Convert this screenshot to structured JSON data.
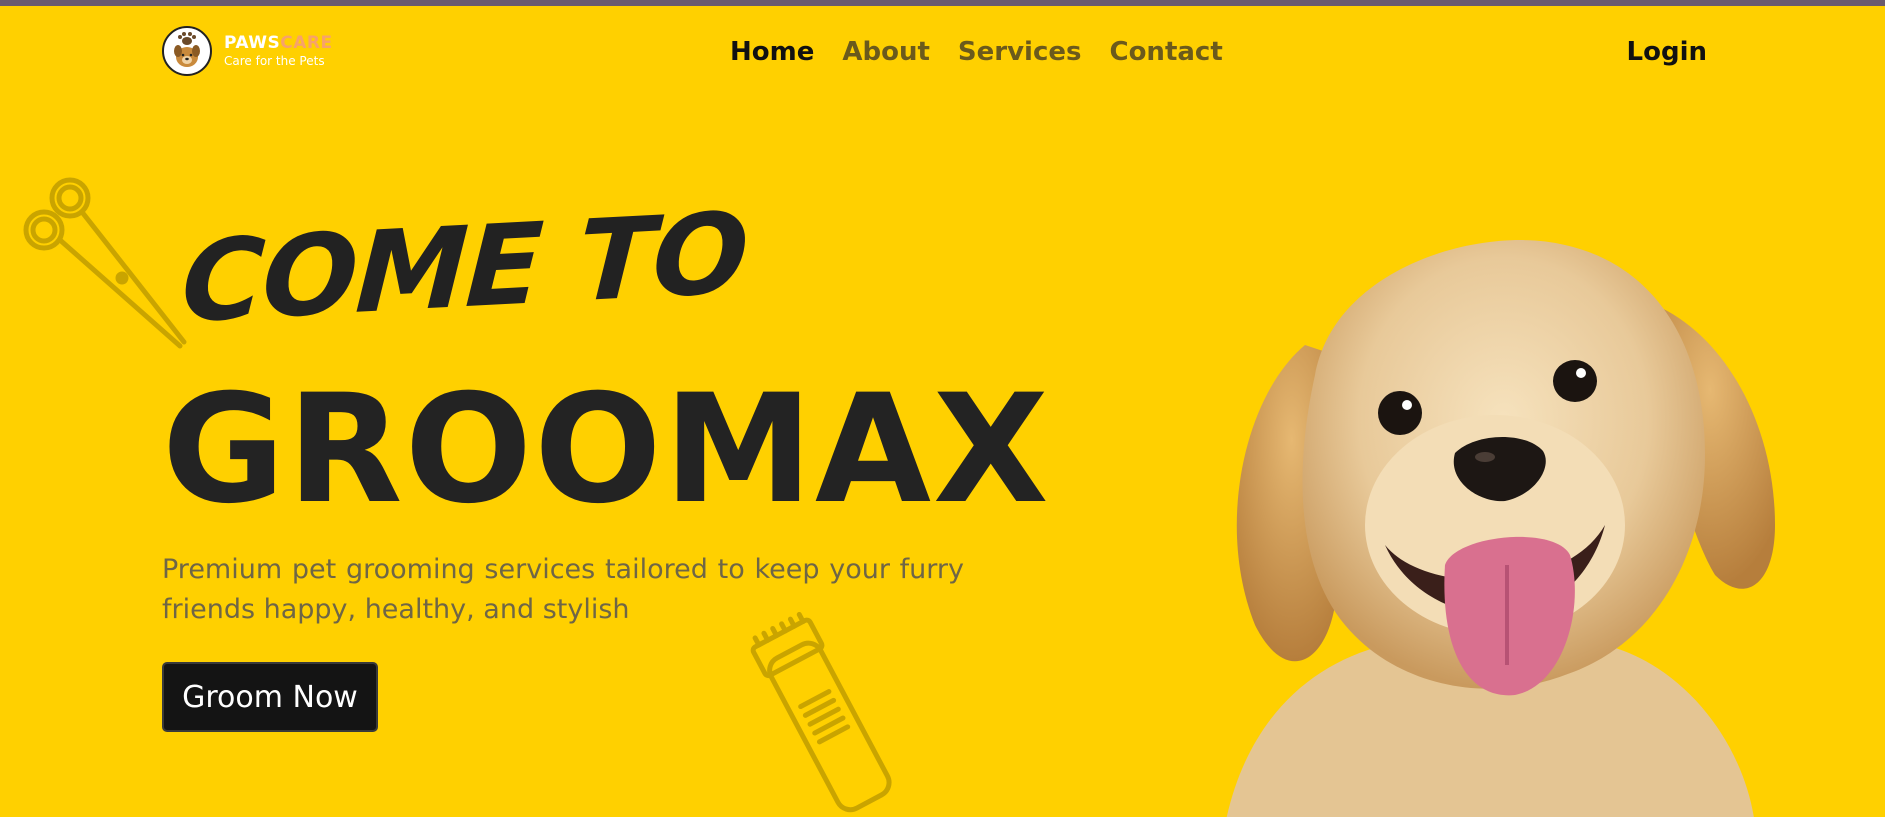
{
  "brand": {
    "name_part1": "PAWS",
    "name_part2": "CARE",
    "tagline": "Care for the Pets",
    "logo_icon": "paw-pet-icon"
  },
  "nav": {
    "items": [
      {
        "label": "Home",
        "active": true
      },
      {
        "label": "About",
        "active": false
      },
      {
        "label": "Services",
        "active": false
      },
      {
        "label": "Contact",
        "active": false
      }
    ],
    "login_label": "Login"
  },
  "hero": {
    "script_line": "COME TO",
    "title": "GROOMAX",
    "description": "Premium pet grooming services tailored to keep your furry friends happy, healthy, and stylish",
    "cta_label": "Groom Now"
  },
  "decorations": {
    "icons": [
      "scissors-icon",
      "hair-clipper-icon"
    ],
    "image": "golden-retriever-puppy"
  },
  "colors": {
    "background": "#FFD000",
    "top_strip": "#6b5b6e",
    "text_dark": "#232323",
    "nav_inactive": "#6b5a1c",
    "brand_accent": "#F7A26B",
    "button_bg": "#141414"
  }
}
